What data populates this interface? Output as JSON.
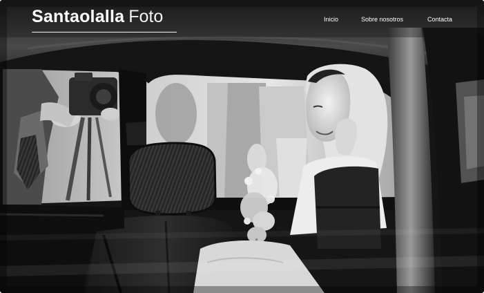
{
  "header": {
    "brand_bold": "Santaolalla",
    "brand_light": "Foto"
  },
  "nav": {
    "items": [
      {
        "label": "Inicio"
      },
      {
        "label": "Sobre nosotros"
      },
      {
        "label": "Contacta"
      }
    ]
  },
  "hero": {
    "style": "black-and-white photograph"
  }
}
